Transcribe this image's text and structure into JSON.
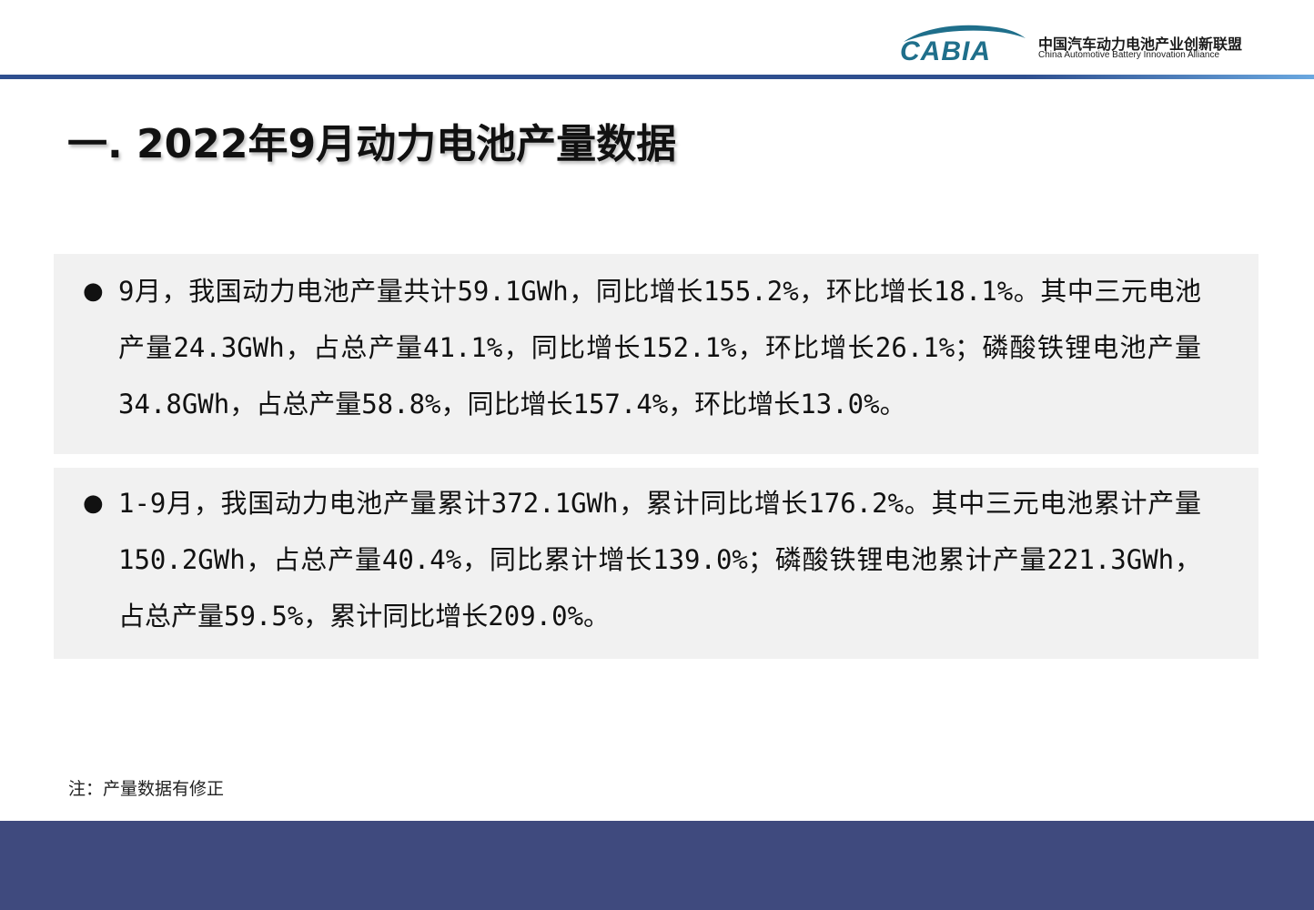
{
  "header": {
    "logo_mark_text": "CABIA",
    "org_name_cn": "中国汽车动力电池产业创新联盟",
    "org_name_en": "China Automotive Battery Innovation Alliance",
    "colors": {
      "header_line": "#2f4f8f",
      "logo_teal": "#1f6f8b",
      "footer_band": "#3f4a7e"
    }
  },
  "title": "一. 2022年9月动力电池产量数据",
  "sections": [
    {
      "bullet": "●",
      "text": "9月，我国动力电池产量共计59.1GWh，同比增长155.2%，环比增长18.1%。其中三元电池产量24.3GWh，占总产量41.1%，同比增长152.1%，环比增长26.1%；磷酸铁锂电池产量34.8GWh，占总产量58.8%，同比增长157.4%，环比增长13.0%。"
    },
    {
      "bullet": "●",
      "text": "1-9月，我国动力电池产量累计372.1GWh，累计同比增长176.2%。其中三元电池累计产量150.2GWh，占总产量40.4%，同比累计增长139.0%；磷酸铁锂电池累计产量221.3GWh，占总产量59.5%，累计同比增长209.0%。"
    }
  ],
  "note": "注：产量数据有修正"
}
